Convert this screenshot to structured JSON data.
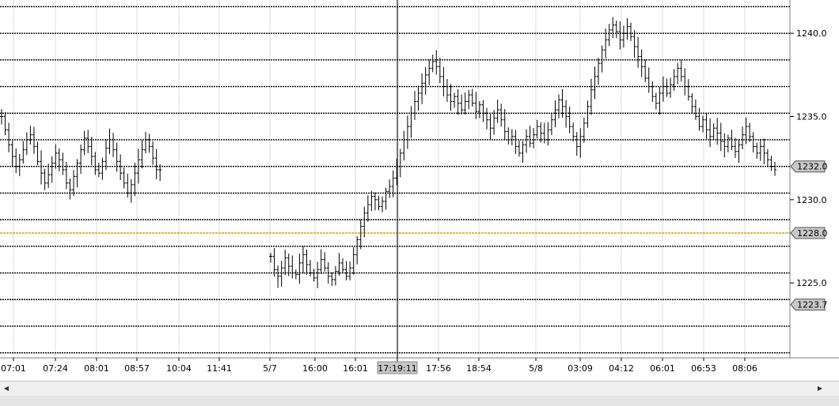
{
  "chart_data": {
    "type": "bar",
    "subtype": "ohlc-bars",
    "title": "",
    "xlabel": "",
    "ylabel": "",
    "ylim": [
      1220.5,
      1242
    ],
    "y_ticks": [
      1240.0,
      1235.0,
      1230.0,
      1225.0
    ],
    "y_tick_labels": [
      "1240.0",
      "1235.0",
      "1230.0",
      "1225.0"
    ],
    "horizontal_levels": [
      1241.6,
      1240.0,
      1238.4,
      1236.8,
      1235.2,
      1233.6,
      1232.0,
      1230.4,
      1228.8,
      1227.2,
      1225.6,
      1224.0,
      1222.4,
      1220.8
    ],
    "x_tick_labels": [
      "07:01",
      "07:24",
      "08:01",
      "08:57",
      "10:04",
      "11:41",
      "5/7",
      "16:00",
      "16:01",
      "17:56",
      "18:54",
      "5/8",
      "03:09",
      "04:12",
      "06:01",
      "06:53",
      "08:06"
    ],
    "crosshair_time_label": "17:19:11",
    "price_markers": [
      {
        "label": "1232.0",
        "value": 1232.0,
        "color": "#c8c8c8"
      },
      {
        "label": "1228.0",
        "value": 1228.0,
        "color": "#c8c8c8",
        "line_color": "#e0a000"
      },
      {
        "label": "1223.7",
        "value": 1223.7,
        "color": "#c8c8c8"
      }
    ],
    "series": [
      {
        "segment": "session-1",
        "close": [
          1235.0,
          1234.2,
          1233.3,
          1232.6,
          1232.0,
          1232.4,
          1233.0,
          1233.6,
          1233.9,
          1233.2,
          1232.3,
          1231.6,
          1231.0,
          1231.5,
          1232.2,
          1232.8,
          1232.4,
          1231.8,
          1231.0,
          1230.6,
          1231.4,
          1232.2,
          1233.0,
          1233.7,
          1233.2,
          1232.6,
          1231.8,
          1231.6,
          1232.3,
          1233.1,
          1233.6,
          1233.0,
          1232.3,
          1231.6,
          1231.0,
          1230.4,
          1230.9,
          1231.6,
          1232.4,
          1233.0,
          1233.6,
          1233.2,
          1232.5,
          1231.8,
          1231.8
        ]
      },
      {
        "segment": "session-2",
        "close": [
          1226.6,
          1225.8,
          1225.4,
          1225.9,
          1226.5,
          1226.0,
          1225.6,
          1225.5,
          1226.2,
          1226.7,
          1226.1,
          1225.6,
          1225.3,
          1225.8,
          1226.4,
          1225.9,
          1225.4,
          1225.2,
          1225.7,
          1226.2,
          1225.8,
          1225.4,
          1225.9,
          1226.7,
          1227.6,
          1228.4,
          1229.2,
          1229.7,
          1230.2,
          1230.0,
          1229.6,
          1229.9,
          1230.5,
          1230.8,
          1231.3,
          1232.0,
          1232.8,
          1233.6,
          1234.4,
          1235.2,
          1235.9,
          1236.4,
          1237.0,
          1237.5,
          1237.9,
          1238.3,
          1238.0,
          1237.4,
          1236.8,
          1236.3,
          1235.9,
          1236.2,
          1235.8,
          1235.4,
          1235.9,
          1236.3,
          1235.8,
          1235.3,
          1235.7,
          1235.2,
          1234.8,
          1234.3,
          1234.9,
          1235.4,
          1234.8,
          1234.1,
          1233.6,
          1233.8,
          1233.2,
          1232.8,
          1233.3,
          1233.8,
          1233.4,
          1233.9,
          1234.4,
          1234.0,
          1233.6,
          1234.2,
          1234.8,
          1235.4,
          1236.0,
          1235.6,
          1235.0,
          1234.4,
          1233.8,
          1233.2,
          1233.8,
          1234.6,
          1235.6,
          1236.6,
          1237.4,
          1238.2,
          1239.0,
          1239.6,
          1240.2,
          1240.5,
          1240.1,
          1239.6,
          1240.0,
          1240.4,
          1239.8,
          1239.2,
          1238.6,
          1238.0,
          1237.3,
          1236.8,
          1236.2,
          1235.8,
          1236.4,
          1236.8,
          1236.4,
          1236.9,
          1237.4,
          1237.9,
          1237.4,
          1236.8,
          1236.2,
          1235.6,
          1235.0,
          1234.4,
          1234.8,
          1234.2,
          1233.8,
          1234.3,
          1234.0,
          1233.5,
          1233.2,
          1233.7,
          1233.2,
          1232.9,
          1233.3,
          1233.9,
          1234.4,
          1233.8,
          1233.2,
          1232.8,
          1233.2,
          1232.8,
          1232.4,
          1232.0,
          1231.8
        ]
      }
    ],
    "grid": true,
    "legend": "none"
  }
}
